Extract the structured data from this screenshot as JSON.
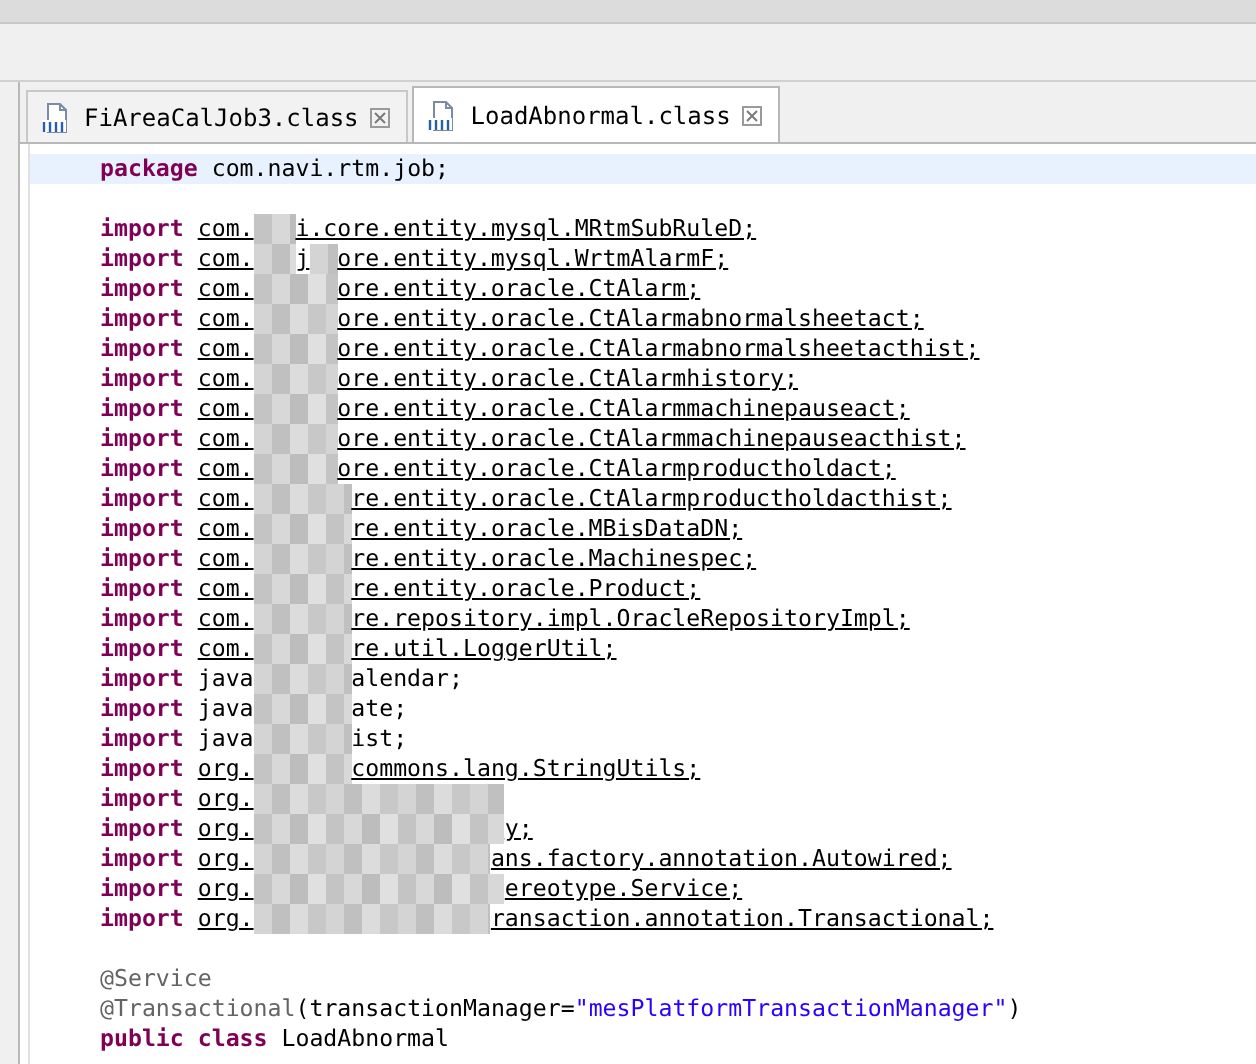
{
  "tabs": [
    {
      "label": "FiAreaCalJob3.class",
      "selected": false
    },
    {
      "label": "LoadAbnormal.class",
      "selected": true
    }
  ],
  "code_lines": [
    {
      "current": true,
      "tokens": [
        {
          "kind": "keyword",
          "text": "package"
        },
        {
          "kind": "plain",
          "text": "com.navi.rtm.job;"
        }
      ]
    },
    {
      "current": false
    },
    {
      "current": false,
      "tokens": [
        {
          "kind": "keyword",
          "text": "import"
        },
        {
          "kind": "link",
          "text": "com."
        },
        {
          "kind": "gap"
        },
        {
          "kind": "link",
          "text": "i.core.entity.mysql.MRtmSubRuleD;"
        }
      ]
    },
    {
      "current": false,
      "tokens": [
        {
          "kind": "keyword",
          "text": "import"
        },
        {
          "kind": "link",
          "text": "com."
        },
        {
          "kind": "gap"
        },
        {
          "kind": "link",
          "text": "j"
        },
        {
          "kind": "gap"
        },
        {
          "kind": "link",
          "text": "ore.entity.mysql.WrtmAlarmF;"
        }
      ]
    },
    {
      "current": false,
      "tokens": [
        {
          "kind": "keyword",
          "text": "import"
        },
        {
          "kind": "link",
          "text": "com."
        },
        {
          "kind": "gap"
        },
        {
          "kind": "link",
          "text": "ore.entity.oracle.CtAlarm;"
        }
      ]
    },
    {
      "current": false,
      "tokens": [
        {
          "kind": "keyword",
          "text": "import"
        },
        {
          "kind": "link",
          "text": "com."
        },
        {
          "kind": "gap"
        },
        {
          "kind": "link",
          "text": "ore.entity.oracle.CtAlarmabnormalsheetact;"
        }
      ]
    },
    {
      "current": false,
      "tokens": [
        {
          "kind": "keyword",
          "text": "import"
        },
        {
          "kind": "link",
          "text": "com."
        },
        {
          "kind": "gap"
        },
        {
          "kind": "link",
          "text": "ore.entity.oracle.CtAlarmabnormalsheetacthist;"
        }
      ]
    },
    {
      "current": false,
      "tokens": [
        {
          "kind": "keyword",
          "text": "import"
        },
        {
          "kind": "link",
          "text": "com."
        },
        {
          "kind": "gap"
        },
        {
          "kind": "link",
          "text": "ore.entity.oracle.CtAlarmhistory;"
        }
      ]
    },
    {
      "current": false,
      "tokens": [
        {
          "kind": "keyword",
          "text": "import"
        },
        {
          "kind": "link",
          "text": "com."
        },
        {
          "kind": "gap"
        },
        {
          "kind": "link",
          "text": "ore.entity.oracle.CtAlarmmachinepauseact;"
        }
      ]
    },
    {
      "current": false,
      "tokens": [
        {
          "kind": "keyword",
          "text": "import"
        },
        {
          "kind": "link",
          "text": "com."
        },
        {
          "kind": "gap"
        },
        {
          "kind": "link",
          "text": "ore.entity.oracle.CtAlarmmachinepauseacthist;"
        }
      ]
    },
    {
      "current": false,
      "tokens": [
        {
          "kind": "keyword",
          "text": "import"
        },
        {
          "kind": "link",
          "text": "com."
        },
        {
          "kind": "gap"
        },
        {
          "kind": "link",
          "text": "ore.entity.oracle.CtAlarmproductholdact;"
        }
      ]
    },
    {
      "current": false,
      "tokens": [
        {
          "kind": "keyword",
          "text": "import"
        },
        {
          "kind": "link",
          "text": "com."
        },
        {
          "kind": "gap"
        },
        {
          "kind": "link",
          "text": "re.entity.oracle.CtAlarmproductholdacthist;"
        }
      ]
    },
    {
      "current": false,
      "tokens": [
        {
          "kind": "keyword",
          "text": "import"
        },
        {
          "kind": "link",
          "text": "com."
        },
        {
          "kind": "gap"
        },
        {
          "kind": "link",
          "text": "re.entity.oracle.MBisDataDN;"
        }
      ]
    },
    {
      "current": false,
      "tokens": [
        {
          "kind": "keyword",
          "text": "import"
        },
        {
          "kind": "link",
          "text": "com."
        },
        {
          "kind": "gap"
        },
        {
          "kind": "link",
          "text": "re.entity.oracle.Machinespec;"
        }
      ]
    },
    {
      "current": false,
      "tokens": [
        {
          "kind": "keyword",
          "text": "import"
        },
        {
          "kind": "link",
          "text": "com."
        },
        {
          "kind": "gap"
        },
        {
          "kind": "link",
          "text": "re.entity.oracle.Product;"
        }
      ]
    },
    {
      "current": false,
      "tokens": [
        {
          "kind": "keyword",
          "text": "import"
        },
        {
          "kind": "link",
          "text": "com."
        },
        {
          "kind": "gap"
        },
        {
          "kind": "link",
          "text": "re.repository.impl.OracleRepositoryImpl;"
        }
      ]
    },
    {
      "current": false,
      "tokens": [
        {
          "kind": "keyword",
          "text": "import"
        },
        {
          "kind": "link",
          "text": "com."
        },
        {
          "kind": "gap"
        },
        {
          "kind": "link",
          "text": "re.util.LoggerUtil;"
        }
      ]
    },
    {
      "current": false,
      "tokens": [
        {
          "kind": "keyword",
          "text": "import"
        },
        {
          "kind": "plain",
          "text": "java"
        },
        {
          "kind": "gap"
        },
        {
          "kind": "plain",
          "text": "alendar;"
        }
      ]
    },
    {
      "current": false,
      "tokens": [
        {
          "kind": "keyword",
          "text": "import"
        },
        {
          "kind": "plain",
          "text": "java"
        },
        {
          "kind": "gap"
        },
        {
          "kind": "plain",
          "text": "ate;"
        }
      ]
    },
    {
      "current": false,
      "tokens": [
        {
          "kind": "keyword",
          "text": "import"
        },
        {
          "kind": "plain",
          "text": "java"
        },
        {
          "kind": "gap"
        },
        {
          "kind": "plain",
          "text": "ist;"
        }
      ]
    },
    {
      "current": false,
      "tokens": [
        {
          "kind": "keyword",
          "text": "import"
        },
        {
          "kind": "link",
          "text": "org."
        },
        {
          "kind": "gap"
        },
        {
          "kind": "link",
          "text": "commons.lang.StringUtils;"
        }
      ]
    },
    {
      "current": false,
      "tokens": [
        {
          "kind": "keyword",
          "text": "import"
        },
        {
          "kind": "link",
          "text": "org."
        },
        {
          "kind": "gap"
        }
      ]
    },
    {
      "current": false,
      "tokens": [
        {
          "kind": "keyword",
          "text": "import"
        },
        {
          "kind": "link",
          "text": "org."
        },
        {
          "kind": "gap"
        },
        {
          "kind": "link",
          "text": "y;"
        }
      ]
    },
    {
      "current": false,
      "tokens": [
        {
          "kind": "keyword",
          "text": "import"
        },
        {
          "kind": "link",
          "text": "org."
        },
        {
          "kind": "gap"
        },
        {
          "kind": "link",
          "text": "ans.factory.annotation.Autowired;"
        }
      ]
    },
    {
      "current": false,
      "tokens": [
        {
          "kind": "keyword",
          "text": "import"
        },
        {
          "kind": "link",
          "text": "org."
        },
        {
          "kind": "gap"
        },
        {
          "kind": "link",
          "text": "ereotype.Service;"
        }
      ]
    },
    {
      "current": false,
      "tokens": [
        {
          "kind": "keyword",
          "text": "import"
        },
        {
          "kind": "link",
          "text": "org."
        },
        {
          "kind": "gap"
        },
        {
          "kind": "link",
          "text": "ransaction.annotation.Transactional;"
        }
      ]
    },
    {
      "current": false
    },
    {
      "current": false,
      "tokens": [
        {
          "kind": "annotation",
          "text": "@Service"
        }
      ]
    },
    {
      "current": false,
      "tokens": [
        {
          "kind": "annotation",
          "text": "@Transactional"
        },
        {
          "kind": "plain",
          "text": "(transactionManager="
        },
        {
          "kind": "string",
          "text": "\"mesPlatformTransactionManager\""
        },
        {
          "kind": "plain",
          "text": ")"
        }
      ]
    },
    {
      "current": false,
      "tokens": [
        {
          "kind": "keyword",
          "text": "public"
        },
        {
          "kind": "keyword",
          "text": "class"
        },
        {
          "kind": "plain",
          "text": "LoadAbnormal"
        }
      ]
    }
  ]
}
